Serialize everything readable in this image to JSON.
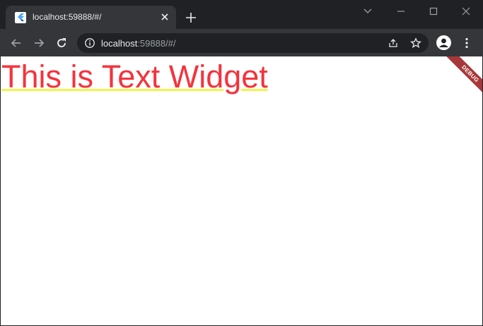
{
  "browser": {
    "tab": {
      "title": "localhost:59888/#/",
      "close_icon": "close-icon",
      "favicon": "flutter-logo-icon"
    },
    "new_tab_icon": "plus-icon",
    "window_controls": [
      "chevron-down-icon",
      "minimize-icon",
      "maximize-icon",
      "close-icon"
    ],
    "toolbar": {
      "back_icon": "arrow-left-icon",
      "forward_icon": "arrow-right-icon",
      "reload_icon": "reload-icon",
      "info_icon": "info-icon",
      "url_host": "localhost",
      "url_rest": ":59888/#/",
      "share_icon": "share-icon",
      "bookmark_icon": "star-icon",
      "profile_icon": "person-icon",
      "menu_icon": "kebab-menu-icon"
    }
  },
  "page": {
    "text_widget": "This is Text Widget",
    "text_color": "#f4333d",
    "underline_color": "#f4f44a",
    "debug_banner": "DEBUG",
    "debug_banner_color": "#a8373a"
  }
}
